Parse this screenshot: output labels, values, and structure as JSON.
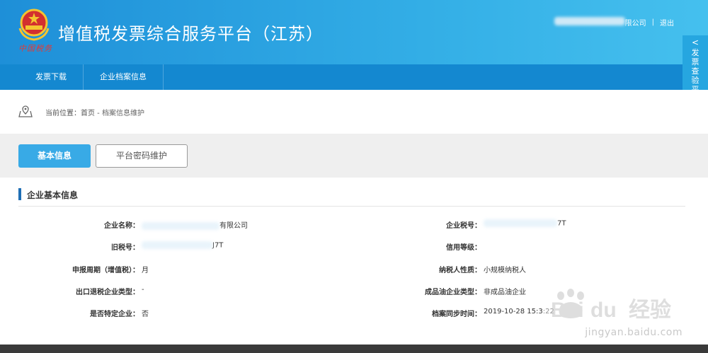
{
  "header": {
    "title": "增值税发票综合服务平台（江苏）",
    "emblem_text": "中国税务",
    "user_suffix": "限公司",
    "separator": "|",
    "logout": "退出"
  },
  "nav": {
    "items": [
      {
        "label": "发票下载"
      },
      {
        "label": "企业档案信息"
      }
    ]
  },
  "side_float": {
    "chevron": "<",
    "label": "发票查验平台"
  },
  "breadcrumb": {
    "prefix": "当前位置：",
    "home": "首页",
    "separator": " - ",
    "current": "档案信息维护"
  },
  "tabs": {
    "basic_info": "基本信息",
    "password": "平台密码维护"
  },
  "section": {
    "title": "企业基本信息"
  },
  "fields": {
    "company_name": {
      "label": "企业名称：",
      "value_suffix": "有限公司"
    },
    "old_tax_no": {
      "label": "旧税号：",
      "value_suffix": "J7T"
    },
    "declare_period": {
      "label": "申报周期（增值税）：",
      "value": "月"
    },
    "export_type": {
      "label": "出口退税企业类型：",
      "value": "-"
    },
    "special": {
      "label": "是否特定企业：",
      "value": "否"
    },
    "tax_no": {
      "label": "企业税号：",
      "value_suffix": "7T"
    },
    "credit_level": {
      "label": "信用等级：",
      "value": ""
    },
    "taxpayer_type": {
      "label": "纳税人性质：",
      "value": "小规模纳税人"
    },
    "oil_type": {
      "label": "成品油企业类型：",
      "value": "非成品油企业"
    },
    "sync_time": {
      "label": "档案同步时间：",
      "value": "2019-10-28 15:3",
      "value_tail": ":22"
    }
  },
  "watermark": {
    "brand": "Bai",
    "brand2": "du",
    "cn": "经验",
    "url": "jingyan.baidu.com"
  },
  "colors": {
    "header_start": "#1e8fd8",
    "nav": "#1488d0",
    "primary": "#38aae6",
    "section_bar": "#1f6fb5"
  }
}
